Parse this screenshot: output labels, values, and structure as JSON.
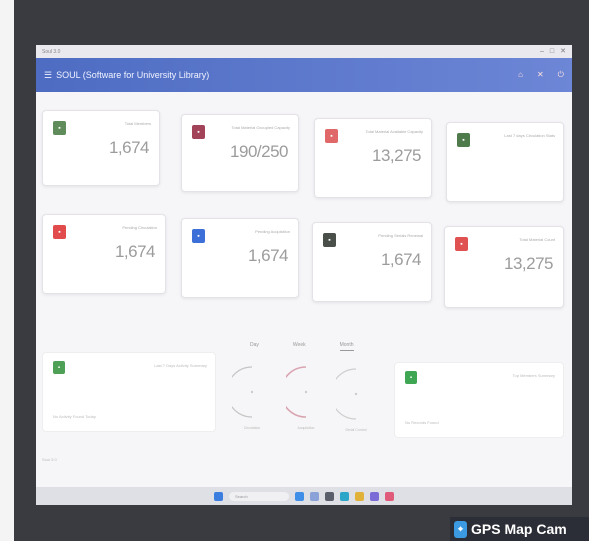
{
  "app": {
    "title": "SOUL (Software for University Library)",
    "window_title": "Soul 3.0"
  },
  "titlebar_controls": [
    "–",
    "□",
    "✕"
  ],
  "appbar_actions": [
    "home-icon",
    "close-icon",
    "logout-icon"
  ],
  "cards": [
    {
      "label": "Total Members",
      "value": "1,674",
      "icon": "member-icon",
      "color": "#5f8c5a"
    },
    {
      "label": "Total Material Occupied Capacity",
      "value": "190/250",
      "icon": "book-icon",
      "color": "#a3435a"
    },
    {
      "label": "Total Material Available Capacity",
      "value": "13,275",
      "icon": "stack-icon",
      "color": "#e06868"
    },
    {
      "label": "Last 7 days Circulation Stats",
      "value": "",
      "icon": "chart-icon",
      "color": "#4f7b4c"
    },
    {
      "label": "Pending Circulation",
      "value": "1,674",
      "icon": "alert-icon",
      "color": "#e24b4b"
    },
    {
      "label": "Pending Acquisition",
      "value": "1,674",
      "icon": "cart-icon",
      "color": "#3c6fd8"
    },
    {
      "label": "Pending Serials Renewal",
      "value": "1,674",
      "icon": "serial-icon",
      "color": "#4a4f4a"
    },
    {
      "label": "Total Material Count",
      "value": "13,275",
      "icon": "books-icon",
      "color": "#e05252"
    }
  ],
  "lower": {
    "left_card": {
      "label": "Last 7 Days Activity Summary",
      "sub": "No Activity Found Today",
      "icon": "activity-icon",
      "color": "#4fa057"
    },
    "right_card": {
      "label": "Top Members Summary",
      "sub": "No Records Found",
      "icon": "users-icon",
      "color": "#3fa653"
    },
    "tabs": [
      "Day",
      "Week",
      "Month"
    ],
    "active_tab": "Month",
    "gauges": [
      {
        "caption": "Circulation",
        "color": "#c5c5c5"
      },
      {
        "caption": "Acquisition",
        "color": "#d9a4b1"
      },
      {
        "caption": "Serial Control",
        "color": "#cfcfcf"
      }
    ]
  },
  "status_text": "Soul 3.0",
  "taskbar": {
    "search_placeholder": "Search",
    "icons": [
      "windows-icon",
      "files-icon",
      "explorer-icon",
      "store-icon",
      "edge-icon",
      "chrome-icon",
      "mail-icon",
      "app-icon"
    ]
  },
  "watermark": {
    "text": "GPS Map Cam"
  }
}
